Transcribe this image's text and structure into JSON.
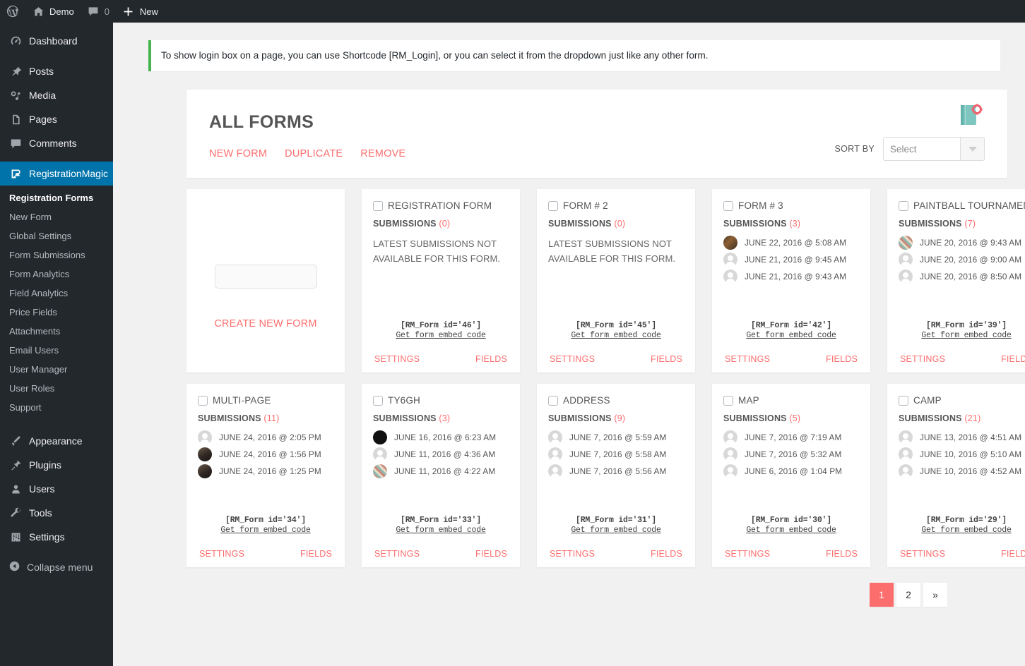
{
  "adminbar": {
    "wp_logo": "wordpress-logo-icon",
    "site_name": "Demo",
    "comments_count": "0",
    "new_label": "New"
  },
  "sidebar": {
    "top_items": [
      {
        "label": "Dashboard",
        "icon": "dashboard-icon"
      },
      {
        "label": "Posts",
        "icon": "pin-icon"
      },
      {
        "label": "Media",
        "icon": "media-icon"
      },
      {
        "label": "Pages",
        "icon": "pages-icon"
      },
      {
        "label": "Comments",
        "icon": "comment-icon"
      }
    ],
    "current_item": {
      "label": "RegistrationMagic",
      "icon": "registrationmagic-icon"
    },
    "submenu": [
      {
        "label": "Registration Forms",
        "current": true
      },
      {
        "label": "New Form",
        "current": false
      },
      {
        "label": "Global Settings",
        "current": false
      },
      {
        "label": "Form Submissions",
        "current": false
      },
      {
        "label": "Form Analytics",
        "current": false
      },
      {
        "label": "Field Analytics",
        "current": false
      },
      {
        "label": "Price Fields",
        "current": false
      },
      {
        "label": "Attachments",
        "current": false
      },
      {
        "label": "Email Users",
        "current": false
      },
      {
        "label": "User Manager",
        "current": false
      },
      {
        "label": "User Roles",
        "current": false
      },
      {
        "label": "Support",
        "current": false
      }
    ],
    "bottom_items": [
      {
        "label": "Appearance",
        "icon": "appearance-icon"
      },
      {
        "label": "Plugins",
        "icon": "plugin-icon"
      },
      {
        "label": "Users",
        "icon": "users-icon"
      },
      {
        "label": "Tools",
        "icon": "tools-icon"
      },
      {
        "label": "Settings",
        "icon": "settings-icon"
      }
    ],
    "collapse_label": "Collapse menu"
  },
  "notice": {
    "text": "To show login box on a page, you can use Shortcode [RM_Login], or you can select it from the dropdown just like any other form.",
    "accent_color": "#46b450"
  },
  "panel": {
    "title": "ALL FORMS",
    "actions": [
      {
        "label": "NEW FORM",
        "name": "new-form-action"
      },
      {
        "label": "DUPLICATE",
        "name": "duplicate-action"
      },
      {
        "label": "REMOVE",
        "name": "remove-action"
      }
    ],
    "sort_label": "SORT BY",
    "sort_value": "Select",
    "notebook_icon": "notebook-gear-icon",
    "accent_color": "#fc6d6d"
  },
  "new_form_card": {
    "label": "CREATE NEW FORM"
  },
  "card_labels": {
    "submissions": "SUBMISSIONS",
    "empty": "LATEST SUBMISSIONS NOT AVAILABLE FOR THIS FORM.",
    "embed_link": "Get form embed code",
    "settings": "SETTINGS",
    "fields": "FIELDS"
  },
  "forms": [
    {
      "title": "REGISTRATION FORM",
      "count": "(0)",
      "empty": true,
      "submissions": [],
      "shortcode": "[RM_Form id='46']"
    },
    {
      "title": "FORM # 2",
      "count": "(0)",
      "empty": true,
      "submissions": [],
      "shortcode": "[RM_Form id='45']"
    },
    {
      "title": "FORM # 3",
      "count": "(3)",
      "empty": false,
      "submissions": [
        {
          "date": "JUNE 22, 2016 @ 5:08 AM",
          "avatar": "p1"
        },
        {
          "date": "JUNE 21, 2016 @ 9:45 AM",
          "avatar": "blank"
        },
        {
          "date": "JUNE 21, 2016 @ 9:43 AM",
          "avatar": "blank"
        }
      ],
      "shortcode": "[RM_Form id='42']"
    },
    {
      "title": "PAINTBALL TOURNAMENT",
      "count": "(7)",
      "empty": false,
      "submissions": [
        {
          "date": "JUNE 20, 2016 @ 9:43 AM",
          "avatar": "p2"
        },
        {
          "date": "JUNE 20, 2016 @ 9:00 AM",
          "avatar": "blank"
        },
        {
          "date": "JUNE 20, 2016 @ 8:50 AM",
          "avatar": "blank"
        }
      ],
      "shortcode": "[RM_Form id='39']"
    },
    {
      "title": "MULTI-PAGE",
      "count": "(11)",
      "empty": false,
      "submissions": [
        {
          "date": "JUNE 24, 2016 @ 2:05 PM",
          "avatar": "blank"
        },
        {
          "date": "JUNE 24, 2016 @ 1:56 PM",
          "avatar": "p3"
        },
        {
          "date": "JUNE 24, 2016 @ 1:25 PM",
          "avatar": "p3"
        }
      ],
      "shortcode": "[RM_Form id='34']"
    },
    {
      "title": "TY6GH",
      "count": "(3)",
      "empty": false,
      "submissions": [
        {
          "date": "JUNE 16, 2016 @ 6:23 AM",
          "avatar": "p4"
        },
        {
          "date": "JUNE 11, 2016 @ 4:36 AM",
          "avatar": "blank"
        },
        {
          "date": "JUNE 11, 2016 @ 4:22 AM",
          "avatar": "p2"
        }
      ],
      "shortcode": "[RM_Form id='33']"
    },
    {
      "title": "ADDRESS",
      "count": "(9)",
      "empty": false,
      "submissions": [
        {
          "date": "JUNE 7, 2016 @ 5:59 AM",
          "avatar": "blank"
        },
        {
          "date": "JUNE 7, 2016 @ 5:58 AM",
          "avatar": "blank"
        },
        {
          "date": "JUNE 7, 2016 @ 5:56 AM",
          "avatar": "blank"
        }
      ],
      "shortcode": "[RM_Form id='31']"
    },
    {
      "title": "MAP",
      "count": "(5)",
      "empty": false,
      "submissions": [
        {
          "date": "JUNE 7, 2016 @ 7:19 AM",
          "avatar": "blank"
        },
        {
          "date": "JUNE 7, 2016 @ 5:32 AM",
          "avatar": "blank"
        },
        {
          "date": "JUNE 6, 2016 @ 1:04 PM",
          "avatar": "blank"
        }
      ],
      "shortcode": "[RM_Form id='30']"
    },
    {
      "title": "CAMP",
      "count": "(21)",
      "empty": false,
      "submissions": [
        {
          "date": "JUNE 13, 2016 @ 4:51 AM",
          "avatar": "blank"
        },
        {
          "date": "JUNE 10, 2016 @ 5:10 AM",
          "avatar": "blank"
        },
        {
          "date": "JUNE 10, 2016 @ 4:52 AM",
          "avatar": "blank"
        }
      ],
      "shortcode": "[RM_Form id='29']"
    }
  ],
  "pagination": [
    {
      "label": "1",
      "active": true
    },
    {
      "label": "2",
      "active": false
    },
    {
      "label": "»",
      "active": false
    }
  ]
}
